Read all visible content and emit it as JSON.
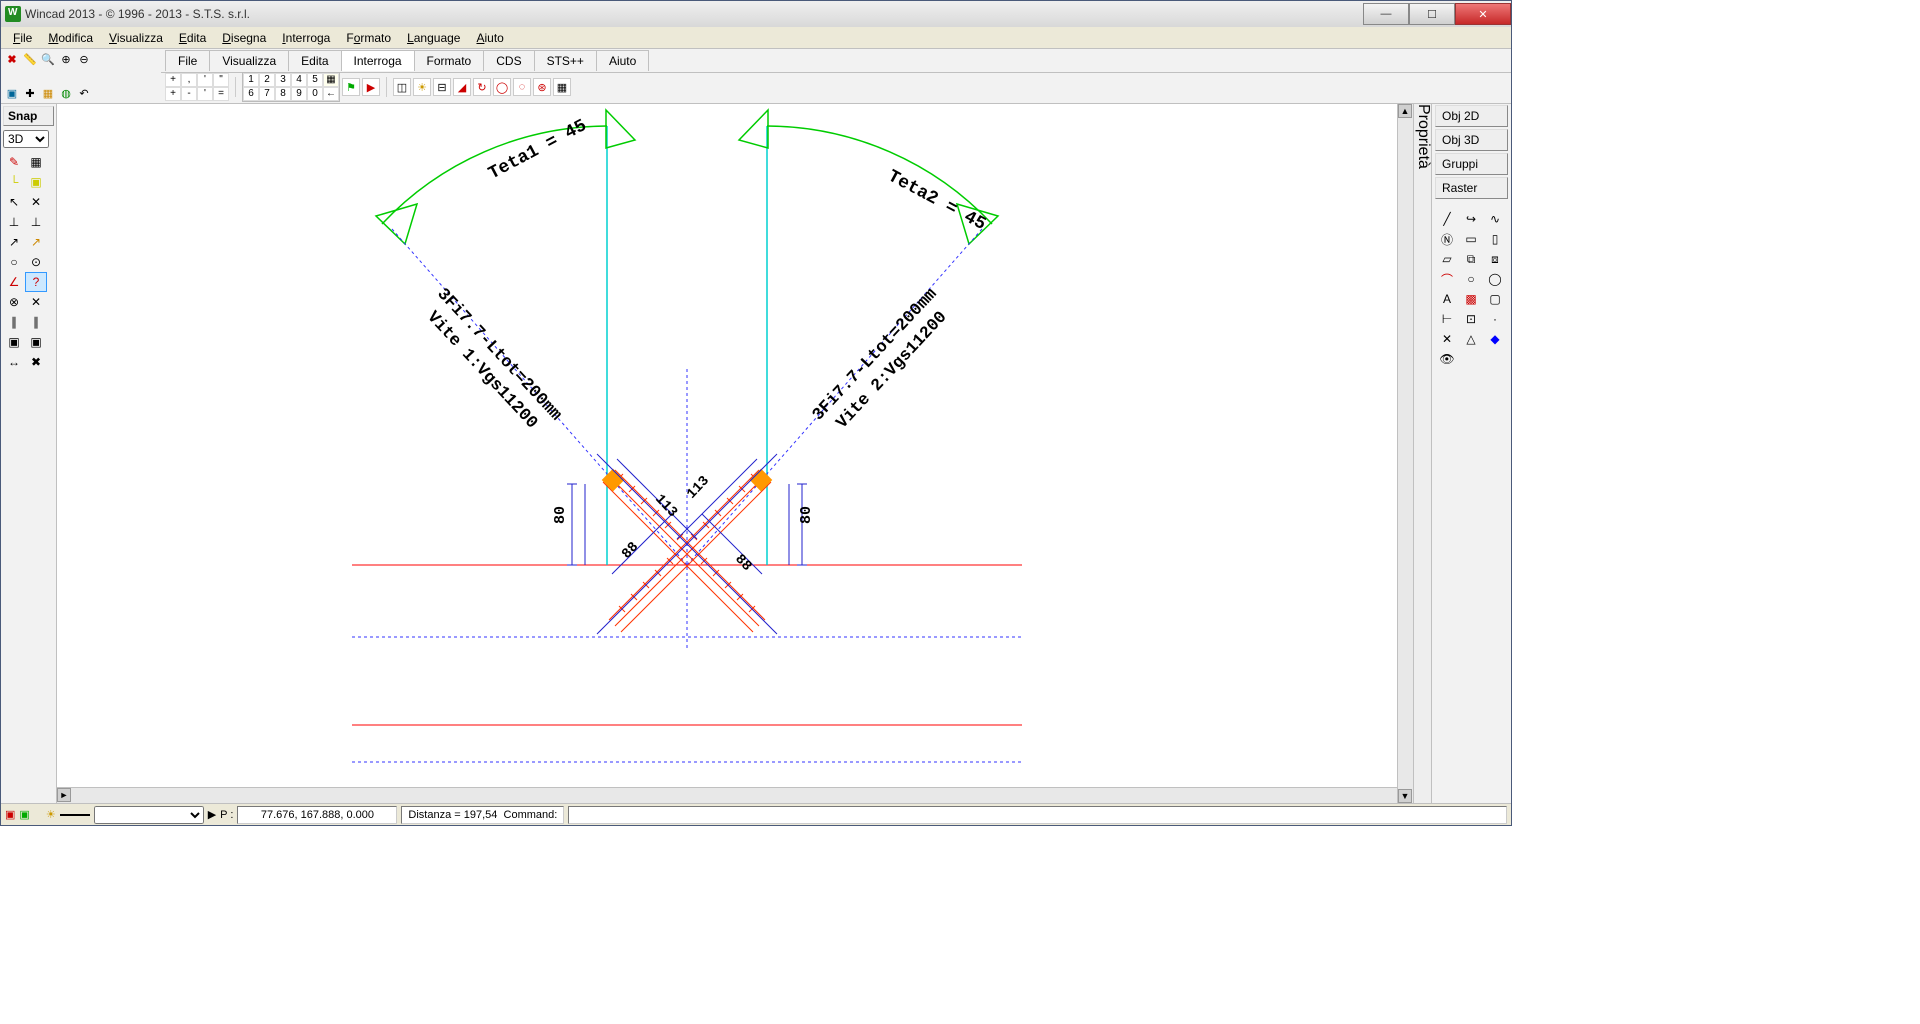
{
  "title": "Wincad 2013 -   © 1996 - 2013 - S.T.S. s.r.l.",
  "menu": [
    "File",
    "Modifica",
    "Visualizza",
    "Edita",
    "Disegna",
    "Interroga",
    "Formato",
    "Language",
    "Aiuto"
  ],
  "tabs": [
    "File",
    "Visualizza",
    "Edita",
    "Interroga",
    "Formato",
    "CDS",
    "STS++",
    "Aiuto"
  ],
  "active_tab": "Interroga",
  "snap_label": "Snap",
  "view_mode": "3D",
  "right_tabs": [
    "Obj 2D",
    "Obj 3D",
    "Gruppi",
    "Raster"
  ],
  "right_vert_tab": "Proprietà",
  "drawing": {
    "teta1": "Teta1 = 45",
    "teta2": "Teta2 = 45",
    "screw1_line1": "3Fi7.7-Ltot=200mm",
    "screw1_line2": "Vite 1:Vgs11200",
    "screw2_line1": "3Fi7.7-Ltot=200mm",
    "screw2_line2": "Vite 2:Vgs11200",
    "dim_v_left": "80",
    "dim_v_right": "80",
    "dim_diag_tl": "113",
    "dim_diag_tr": "113",
    "dim_diag_bl": "88",
    "dim_diag_br": "88"
  },
  "status": {
    "coords": "77.676, 167.888, 0.000",
    "dist_label": "Distanza  = 197,54",
    "cmd_label": "Command:",
    "p_label": "P :"
  }
}
